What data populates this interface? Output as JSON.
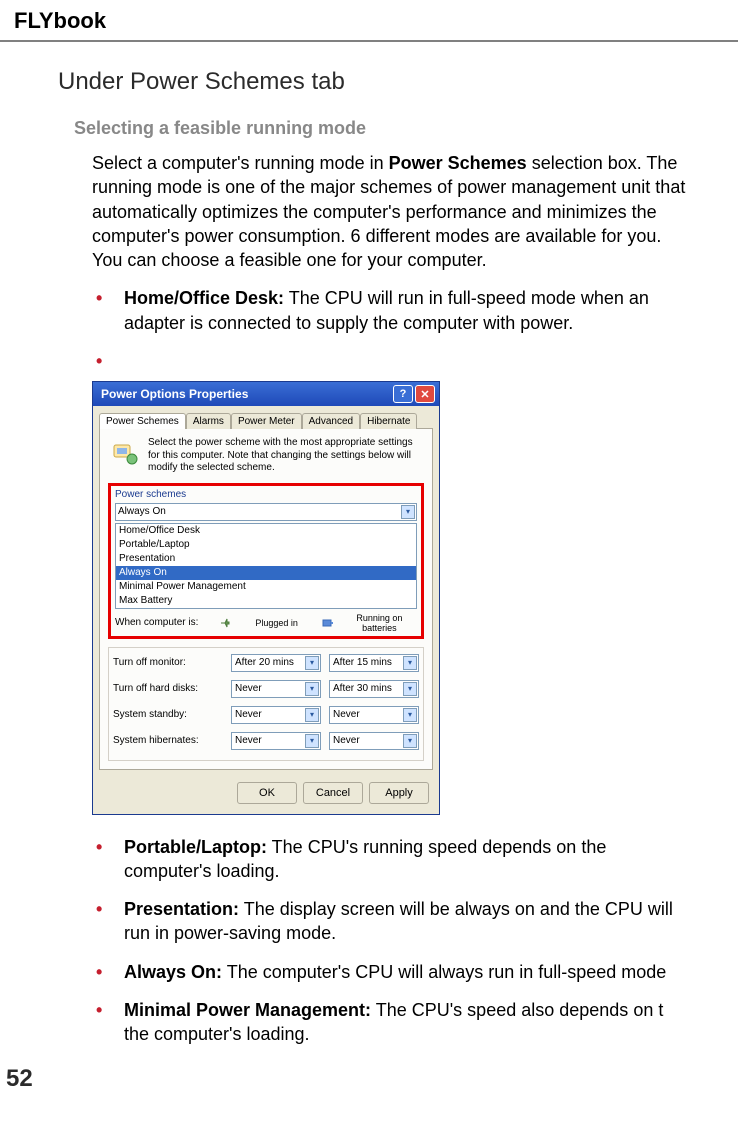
{
  "logo": "FLYbook",
  "section_title": "Under Power Schemes tab",
  "subsection_title": "Selecting a feasible running mode",
  "intro_prefix": "Select a computer's running mode in ",
  "intro_bold": "Power Schemes",
  "intro_suffix": " selection box. The running mode is one of the major schemes of power management unit that automatically optimizes the computer's performance and minimizes the computer's power consumption. 6 different modes are available for you. You can choose a feasible one for your computer.",
  "modes_before": [
    {
      "label": "Home/Office Desk:",
      "text": " The CPU will run in full-speed mode when an adapter is connected to supply the computer with power."
    }
  ],
  "modes_after": [
    {
      "label": "Portable/Laptop:",
      "text": " The CPU's running speed depends on the computer's loading."
    },
    {
      "label": "Presentation:",
      "text": " The display screen will be always on and the CPU will run in power-saving mode."
    },
    {
      "label": "Always On:",
      "text": " The computer's CPU will always run in full-speed mode"
    },
    {
      "label": "Minimal Power Management:",
      "text": " The CPU's speed also depends on t the computer's loading."
    }
  ],
  "dialog": {
    "title": "Power Options Properties",
    "help": "?",
    "close": "✕",
    "tabs": [
      "Power Schemes",
      "Alarms",
      "Power Meter",
      "Advanced",
      "Hibernate"
    ],
    "intro": "Select the power scheme with the most appropriate settings for this computer. Note that changing the settings below will modify the selected scheme.",
    "group_label": "Power schemes",
    "combo_value": "Always On",
    "options": [
      "Home/Office Desk",
      "Portable/Laptop",
      "Presentation",
      "Always On",
      "Minimal Power Management",
      "Max Battery"
    ],
    "selected_index": 3,
    "when_label": "When computer is:",
    "plugged": "Plugged in",
    "battery": "Running on batteries",
    "rows": [
      {
        "label": "Turn off monitor:",
        "plugged": "After 20 mins",
        "battery": "After 15 mins"
      },
      {
        "label": "Turn off hard disks:",
        "plugged": "Never",
        "battery": "After 30 mins"
      },
      {
        "label": "System standby:",
        "plugged": "Never",
        "battery": "Never"
      },
      {
        "label": "System hibernates:",
        "plugged": "Never",
        "battery": "Never"
      }
    ],
    "buttons": {
      "ok": "OK",
      "cancel": "Cancel",
      "apply": "Apply"
    }
  },
  "page_number": "52"
}
